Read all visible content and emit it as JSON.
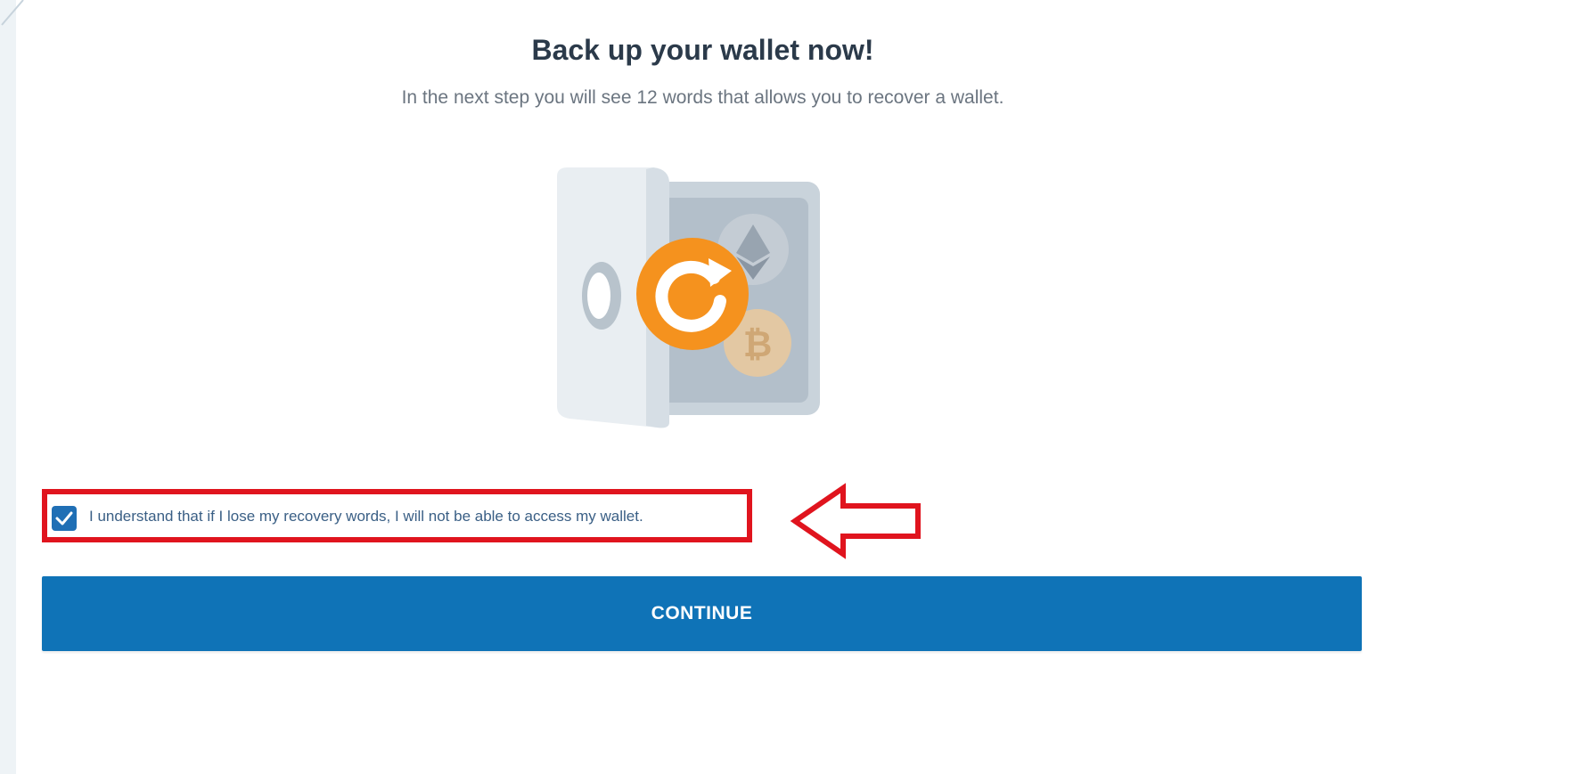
{
  "heading": {
    "title": "Back up your wallet now!",
    "subtitle": "In the next step you will see 12 words that allows you to recover a wallet."
  },
  "illustration": {
    "icons": [
      "safe-icon",
      "refresh-icon",
      "ethereum-icon",
      "bitcoin-icon"
    ]
  },
  "consent": {
    "checked": true,
    "label": "I understand that if I lose my recovery words, I will not be able to access my wallet."
  },
  "annotation": {
    "highlight_color": "#e0141e",
    "arrow_icon": "arrow-left-icon"
  },
  "actions": {
    "continue_label": "CONTINUE"
  },
  "colors": {
    "primary": "#0f73b7",
    "checkbox": "#1f6fb5",
    "accent_orange": "#f5921e"
  }
}
